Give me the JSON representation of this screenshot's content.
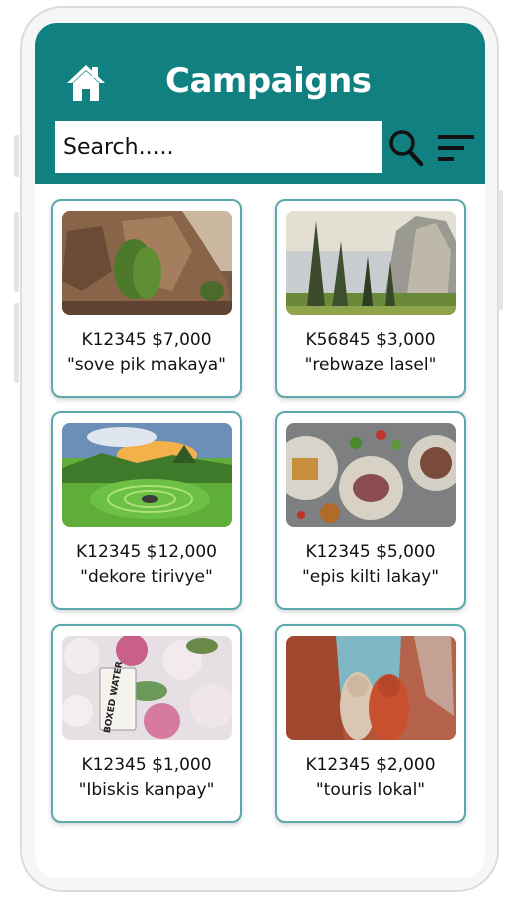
{
  "header": {
    "title": "Campaigns",
    "home_icon": "home-icon",
    "search_icon": "search-icon",
    "filter_icon": "filter-icon",
    "background_color": "#118080"
  },
  "search": {
    "placeholder": "Search.....",
    "value": ""
  },
  "campaigns": [
    {
      "code_amount": "K12345   $7,000",
      "name": "\"sove pik makaya\"",
      "image": "mossy rock cliff"
    },
    {
      "code_amount": "K56845 $3,000",
      "name": "\"rebwaze lasel\"",
      "image": "valley with pine trees and granite cliff"
    },
    {
      "code_amount": "K12345   $12,000",
      "name": "\"dekore tirivye\"",
      "image": "green hills with stone circle at sunset"
    },
    {
      "code_amount": "K12345   $5,000",
      "name": "\"epis kilti lakay\"",
      "image": "plates of food on grey table"
    },
    {
      "code_amount": "K12345   $1,000",
      "name": "\"Ibiskis kanpay\"",
      "image": "flowers with Boxed Water carton"
    },
    {
      "code_amount": "K12345 $2,000",
      "name": "\"touris lokal\"",
      "image": "two women among red rock canyon"
    }
  ],
  "image_text": {
    "boxed_water": "BOXED WATER"
  }
}
